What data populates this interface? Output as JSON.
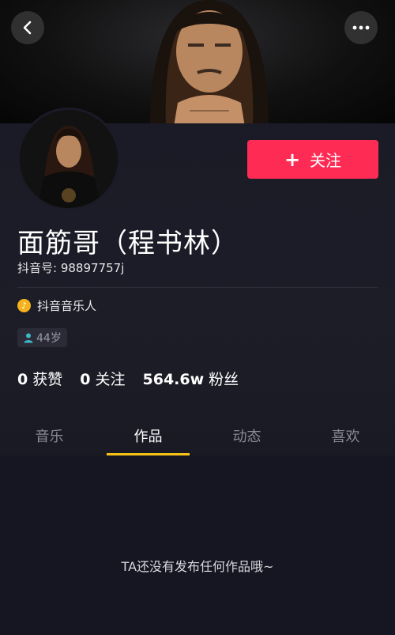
{
  "header": {
    "back_icon": "back-arrow-icon",
    "more_icon": "more-dots-icon"
  },
  "profile": {
    "name": "面筋哥（程书林）",
    "douyin_id": "抖音号: 98897757j",
    "musician_label": "抖音音乐人",
    "age": "44岁",
    "follow_label": "关注",
    "follow_color": "#fe2c55"
  },
  "stats": {
    "likes_value": "0",
    "likes_label": "获赞",
    "following_value": "0",
    "following_label": "关注",
    "fans_value": "564.6w",
    "fans_label": "粉丝"
  },
  "tabs": [
    {
      "label": "音乐"
    },
    {
      "label": "作品"
    },
    {
      "label": "动态"
    },
    {
      "label": "喜欢"
    }
  ],
  "active_tab": "作品",
  "empty_message": "TA还没有发布任何作品哦~"
}
